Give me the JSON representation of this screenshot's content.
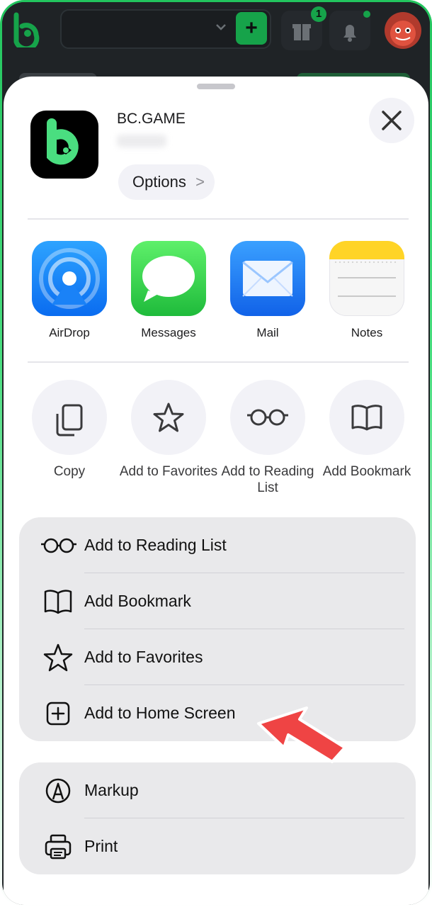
{
  "topbar": {
    "gift_badge": "1",
    "plus_label": "+"
  },
  "sheet": {
    "app_name": "BC.GAME",
    "options_label": "Options",
    "options_chevron": ">",
    "apps": [
      {
        "label": "AirDrop",
        "icon": "airdrop-icon"
      },
      {
        "label": "Messages",
        "icon": "messages-icon"
      },
      {
        "label": "Mail",
        "icon": "mail-icon"
      },
      {
        "label": "Notes",
        "icon": "notes-icon"
      }
    ],
    "actions": [
      {
        "label": "Copy",
        "icon": "copy-icon"
      },
      {
        "label": "Add to Favorites",
        "icon": "star-icon"
      },
      {
        "label": "Add to Reading List",
        "icon": "glasses-icon"
      },
      {
        "label": "Add Bookmark",
        "icon": "book-icon"
      }
    ],
    "menu_group_1": [
      {
        "label": "Add to Reading List",
        "icon": "glasses-icon"
      },
      {
        "label": "Add Bookmark",
        "icon": "book-icon"
      },
      {
        "label": "Add to Favorites",
        "icon": "star-icon"
      },
      {
        "label": "Add to Home Screen",
        "icon": "plus-square-icon"
      }
    ],
    "menu_group_2": [
      {
        "label": "Markup",
        "icon": "markup-icon"
      },
      {
        "label": "Print",
        "icon": "printer-icon"
      }
    ]
  },
  "colors": {
    "brand_green": "#16a34a",
    "arrow_red": "#ef4444"
  }
}
